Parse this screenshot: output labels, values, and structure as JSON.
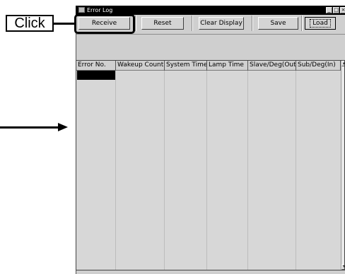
{
  "annotation": {
    "click_label": "Click"
  },
  "window": {
    "title": "Error Log",
    "controls": {
      "minimize": "_",
      "maximize": "□",
      "close": "×"
    }
  },
  "toolbar": {
    "receive": "Receive",
    "reset": "Reset",
    "clear_display": "Clear Display",
    "save": "Save",
    "load": "Load"
  },
  "table": {
    "columns": [
      "Error No.",
      "Wakeup Count",
      "System Time",
      "Lamp Time",
      "Slave/Deg(Out)",
      "Sub/Deg(In)"
    ],
    "rows": []
  },
  "scrollbar": {
    "up": "▲",
    "down": "▼"
  },
  "icons": {
    "window_icon": "window-icon",
    "arrow": "right-arrow-icon"
  }
}
